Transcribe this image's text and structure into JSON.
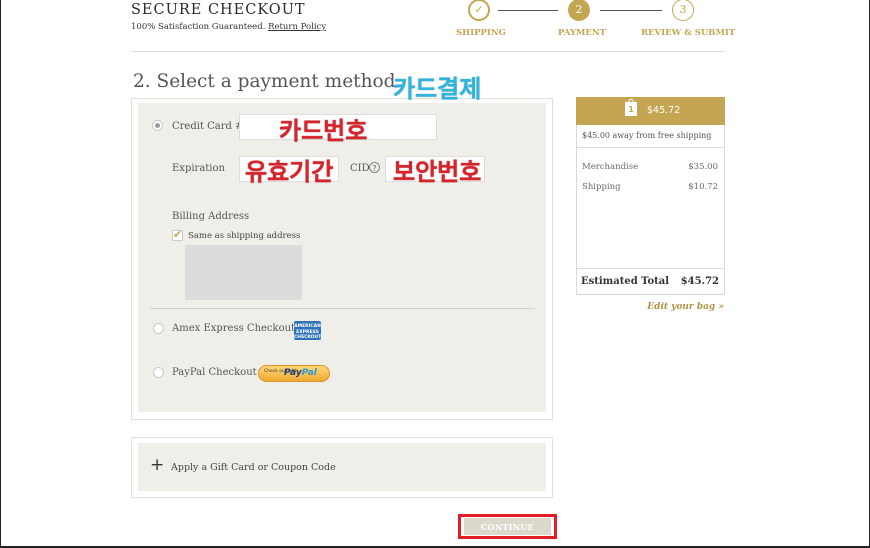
{
  "header": {
    "title": "SECURE CHECKOUT",
    "subtitle": "100% Satisfaction Guaranteed.",
    "return_policy": "Return Policy"
  },
  "steps": [
    {
      "number": "✓",
      "label": "SHIPPING",
      "state": "complete"
    },
    {
      "number": "2",
      "label": "PAYMENT",
      "state": "active"
    },
    {
      "number": "3",
      "label": "REVIEW & SUBMIT",
      "state": "upcoming"
    }
  ],
  "payment": {
    "section_title": "2. Select a payment method",
    "credit_card_label": "Credit Card #",
    "expiration_label": "Expiration",
    "cid_label": "CID",
    "billing_label": "Billing Address",
    "same_as_shipping": "Same as shipping address",
    "same_checked": true,
    "amex_label": "Amex Express Checkout",
    "amex_logo": "AMERICAN EXPRESS CHECKOUT",
    "paypal_label": "PayPal Checkout",
    "paypal_logo_small": "Check out with",
    "paypal_logo_pay": "Pay",
    "paypal_logo_pal": "Pal"
  },
  "annotations": {
    "card_payment": "카드결제",
    "card_number": "카드번호",
    "expiry": "유효기간",
    "security_code": "보안번호"
  },
  "gift": {
    "label": "Apply a Gift Card or Coupon Code"
  },
  "continue_label": "CONTINUE",
  "summary": {
    "bag_count": "1",
    "total_head": "$45.72",
    "free_shipping": "$45.00 away from free shipping",
    "rows": [
      {
        "label": "Merchandise",
        "value": "$35.00"
      },
      {
        "label": "Shipping",
        "value": "$10.72"
      }
    ],
    "estimated_label": "Estimated Total",
    "estimated_value": "$45.72",
    "edit_bag": "Edit your bag »"
  },
  "colors": {
    "accent_gold": "#c4a552",
    "panel_bg": "#efeee9",
    "annotation_red": "#d8232a",
    "annotation_blue": "#2fb5dd"
  },
  "icons": [
    "checkmark-icon",
    "help-icon",
    "bag-icon",
    "plus-icon",
    "amex-logo",
    "paypal-logo"
  ]
}
